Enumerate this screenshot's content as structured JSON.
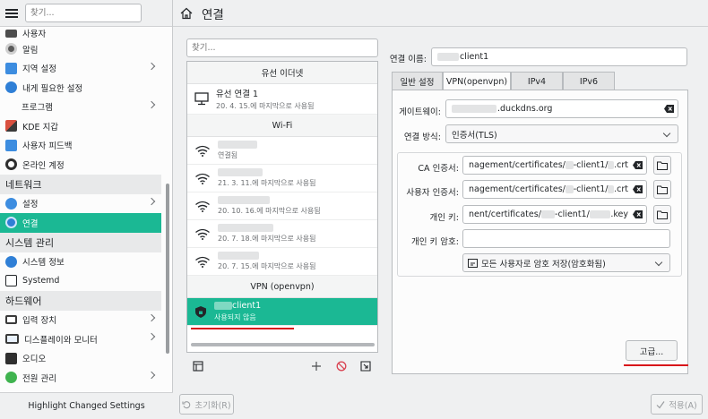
{
  "sidebar": {
    "search_placeholder": "찾기...",
    "items": [
      {
        "label": "사용자",
        "icon": "user-manager-icon",
        "color": "#4d4d4d",
        "chev": false,
        "indent": false,
        "active": false
      },
      {
        "label": "알림",
        "icon": "notification-icon",
        "color": "#5b5b5b",
        "chev": false,
        "indent": false,
        "active": false
      },
      {
        "label": "지역 설정",
        "icon": "region-icon",
        "color": "#3d8de0",
        "chev": true,
        "indent": false,
        "active": false
      },
      {
        "label": "내게 필요한 설정",
        "icon": "accessibility-icon",
        "color": "#2f7fd6",
        "chev": false,
        "indent": false,
        "active": false
      },
      {
        "label": "프로그램",
        "icon": "",
        "color": "",
        "chev": true,
        "indent": true,
        "active": false
      },
      {
        "label": "KDE 지갑",
        "icon": "kde-wallet-icon",
        "color": "#d9503f",
        "chev": false,
        "indent": false,
        "active": false
      },
      {
        "label": "사용자 피드백",
        "icon": "user-feedback-icon",
        "color": "#3d8de0",
        "chev": false,
        "indent": false,
        "active": false
      }
    ],
    "item_online": {
      "label": "온라인 계정",
      "icon": "online-accounts-icon"
    },
    "cat_network": "네트워크",
    "net_items": [
      {
        "label": "설정",
        "icon": "network-settings-icon",
        "chev": true,
        "active": false
      },
      {
        "label": "연결",
        "icon": "connections-icon",
        "chev": false,
        "active": true
      }
    ],
    "cat_system": "시스템 관리",
    "sys_items": [
      {
        "label": "시스템 정보",
        "icon": "system-info-icon"
      },
      {
        "label": "Systemd",
        "icon": "systemd-icon"
      }
    ],
    "cat_hardware": "하드웨어",
    "hw_items": [
      {
        "label": "입력 장치",
        "icon": "input-devices-icon",
        "chev": true
      },
      {
        "label": "디스플레이와 모니터",
        "icon": "display-icon",
        "chev": true
      },
      {
        "label": "오디오",
        "icon": "audio-icon",
        "chev": false
      },
      {
        "label": "전원 관리",
        "icon": "power-icon",
        "chev": true
      }
    ],
    "bottom_label": "Highlight Changed Settings"
  },
  "header": {
    "title": "연결"
  },
  "connections": {
    "search_placeholder": "찾기...",
    "wired_header": "유선 이더넷",
    "wired": {
      "name": "유선 연결 1",
      "sub": "20. 4. 15.에 마지막으로 사용됨"
    },
    "wifi_header": "Wi-Fi",
    "wifi": [
      {
        "sub": "연결됨"
      },
      {
        "sub": "21. 3. 11.에 마지막으로 사용됨"
      },
      {
        "sub": "20. 10. 16.에 마지막으로 사용됨"
      },
      {
        "sub": "20. 7. 18.에 마지막으로 사용됨"
      },
      {
        "sub": "20. 7. 15.에 마지막으로 사용됨"
      }
    ],
    "vpn_header": "VPN (openvpn)",
    "vpn": {
      "name": "client1",
      "sub": "사용되지 않음"
    }
  },
  "detail": {
    "conn_name_label": "연결 이름:",
    "conn_name_value": "client1",
    "tabs": [
      "일반 설정",
      "VPN(openvpn)",
      "IPv4",
      "IPv6"
    ],
    "active_tab": "VPN(openvpn)",
    "gateway_label": "게이트웨이:",
    "gateway_value": ".duckdns.org",
    "conn_type_label": "연결 방식:",
    "conn_type_value": "인증서(TLS)",
    "ca_label": "CA 인증서:",
    "ca_value": "nagement/certificates/",
    "ca_suffix": "-client1/",
    "ca_ext": ".crt",
    "user_cert_label": "사용자 인증서:",
    "user_cert_value": "nagement/certificates/",
    "user_cert_suffix": "-client1/",
    "user_cert_ext": ".crt",
    "key_label": "개인 키:",
    "key_value": "nent/certificates/",
    "key_suffix": "-client1/",
    "key_ext": ".key",
    "key_pw_label": "개인 키 암호:",
    "key_pw_value": "",
    "store_value": "모든 사용자로 암호 저장(암호화됨)",
    "advanced_btn": "고급..."
  },
  "footer": {
    "reset": "초기화(R)",
    "apply": "적용(A)"
  }
}
